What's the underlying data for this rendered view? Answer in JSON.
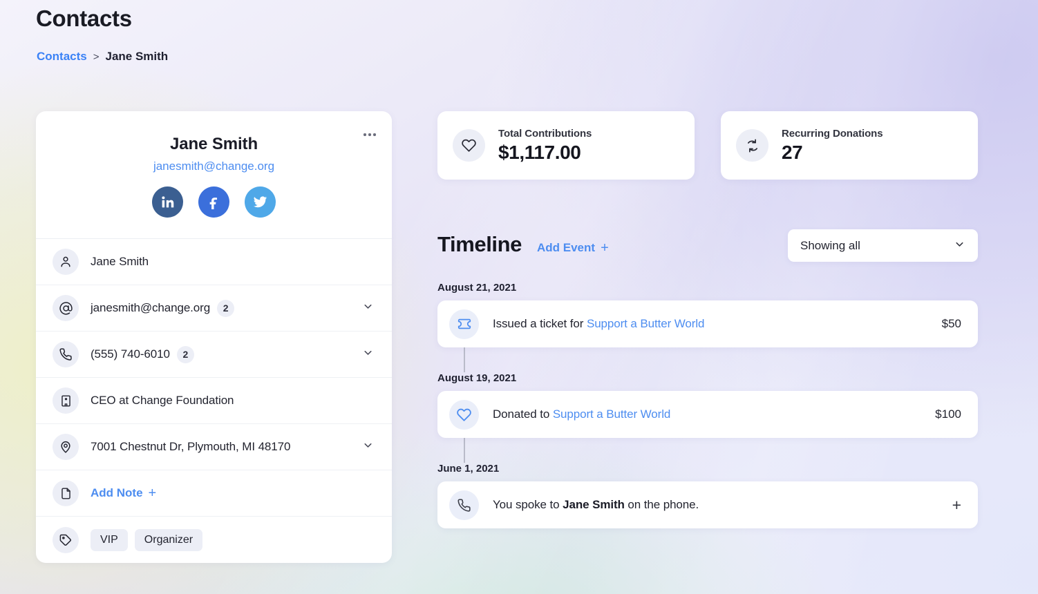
{
  "header": {
    "title": "Contacts",
    "breadcrumb": {
      "root": "Contacts",
      "separator": ">",
      "current": "Jane Smith"
    }
  },
  "contact_card": {
    "menu_icon": "ellipsis-icon",
    "name": "Jane Smith",
    "email": "janesmith@change.org",
    "socials": [
      {
        "name": "linkedin",
        "label": "in",
        "color": "#3b5f91"
      },
      {
        "name": "facebook",
        "label": "f",
        "color": "#3b6fdb"
      },
      {
        "name": "twitter",
        "label": "t",
        "color": "#4fa8e8"
      }
    ],
    "rows": [
      {
        "icon": "person-icon",
        "text": "Jane Smith",
        "badge": null,
        "chevron": false
      },
      {
        "icon": "at-sign-icon",
        "text": "janesmith@change.org",
        "badge": "2",
        "chevron": true
      },
      {
        "icon": "phone-icon",
        "text": "(555) 740-6010",
        "badge": "2",
        "chevron": true
      },
      {
        "icon": "building-icon",
        "text": "CEO at Change Foundation",
        "badge": null,
        "chevron": false
      },
      {
        "icon": "location-pin-icon",
        "text": "7001 Chestnut Dr, Plymouth, MI 48170",
        "badge": null,
        "chevron": true
      }
    ],
    "add_note": {
      "icon": "document-icon",
      "label": "Add Note",
      "plus": "+"
    },
    "tags_row": {
      "icon": "tag-icon",
      "tags": [
        "VIP",
        "Organizer"
      ]
    }
  },
  "stats": [
    {
      "icon": "heart-icon",
      "label": "Total Contributions",
      "value": "$1,117.00"
    },
    {
      "icon": "recurring-icon",
      "label": "Recurring Donations",
      "value": "27"
    }
  ],
  "timeline": {
    "title": "Timeline",
    "add_event": {
      "label": "Add Event",
      "plus": "+"
    },
    "filter": {
      "value": "Showing all",
      "icon": "chevron-down-icon"
    },
    "groups": [
      {
        "date": "August 21, 2021",
        "events": [
          {
            "icon": "ticket-icon",
            "prefix": "Issued a ticket for ",
            "highlight": "Support a Butter World",
            "suffix": "",
            "amount": "$50",
            "action": null
          }
        ]
      },
      {
        "date": "August 19, 2021",
        "events": [
          {
            "icon": "heart-outline-icon",
            "prefix": "Donated to ",
            "highlight": "Support a Butter World",
            "suffix": "",
            "amount": "$100",
            "action": null
          }
        ]
      },
      {
        "date": "June 1, 2021",
        "events": [
          {
            "icon": "phone-icon",
            "prefix": "You spoke to ",
            "bold": "Jane Smith",
            "suffix": " on the phone.",
            "amount": null,
            "action": "+"
          }
        ]
      }
    ]
  },
  "colors": {
    "accent_blue": "#4d8df0",
    "text_dark": "#1b1c27",
    "icon_bg": "#eceef6",
    "event_icon_bg": "#eaeef9"
  }
}
